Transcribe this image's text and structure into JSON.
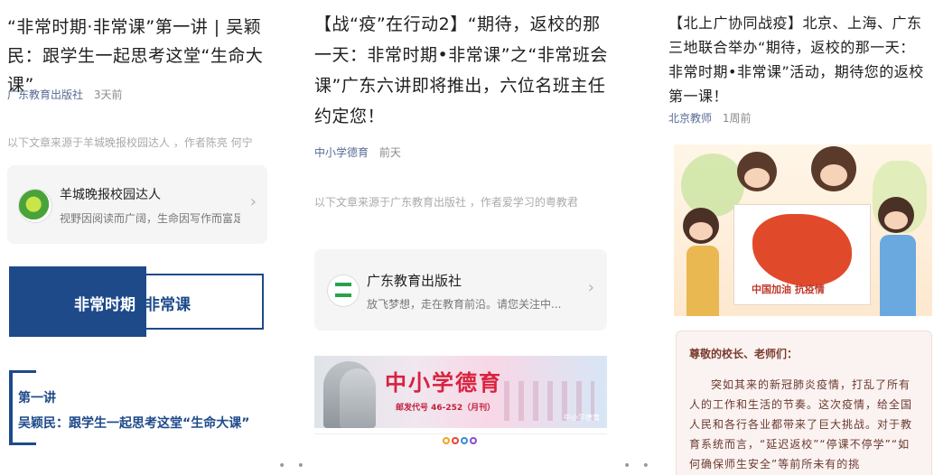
{
  "panel1": {
    "title": "“非常时期·非常课”第一讲 | 吴颖民：跟学生一起思考这堂“生命大课”",
    "source": "广东教育出版社",
    "time": "3天前",
    "from_note": "以下文章来源于羊城晚报校园达人 ，作者陈亮 何宁",
    "card": {
      "name": "羊城晚报校园达人",
      "desc": "视野因阅读而广阔，生命因写作而富足..."
    },
    "banner": {
      "left": "非常时期",
      "right": "非常课"
    },
    "lecture": {
      "label": "第一讲",
      "text": "吴颖民：跟学生一起思考这堂“生命大课”"
    }
  },
  "panel2": {
    "title": "【战“疫”在行动2】“期待，返校的那一天：非常时期•非常课”之“非常班会课”广东六讲即将推出，六位名班主任约定您！",
    "source": "中小学德育",
    "time": "前天",
    "from_note": "以下文章来源于广东教育出版社 ，作者爱学习的粤教君",
    "card": {
      "name": "广东教育出版社",
      "desc": "放飞梦想，走在教育前沿。请您关注中..."
    },
    "banner": {
      "title": "中小学德育",
      "issn": "邮发代号 46-252（月刊）",
      "badge": "中小学德育"
    }
  },
  "panel3": {
    "title": "【北上广协同战疫】北京、上海、广东三地联合举办“期待，返校的那一天：非常时期•非常课”活动，期待您的返校第一课！",
    "source": "北京教师",
    "time": "1周前",
    "poster_text": "中国加油 抗疫情",
    "letter": {
      "greeting": "尊敬的校长、老师们：",
      "body": "突如其来的新冠肺炎疫情，打乱了所有人的工作和生活的节奏。这次疫情，给全国人民和各行各业都带来了巨大挑战。对于教育系统而言，“延迟返校”“停课不停学”“如何确保师生安全”等前所未有的挑"
    }
  },
  "pager": {
    "dots": "• •"
  },
  "colors": {
    "navy": "#1e4a8a",
    "link": "#576b95",
    "map_red": "#e04a2a"
  }
}
